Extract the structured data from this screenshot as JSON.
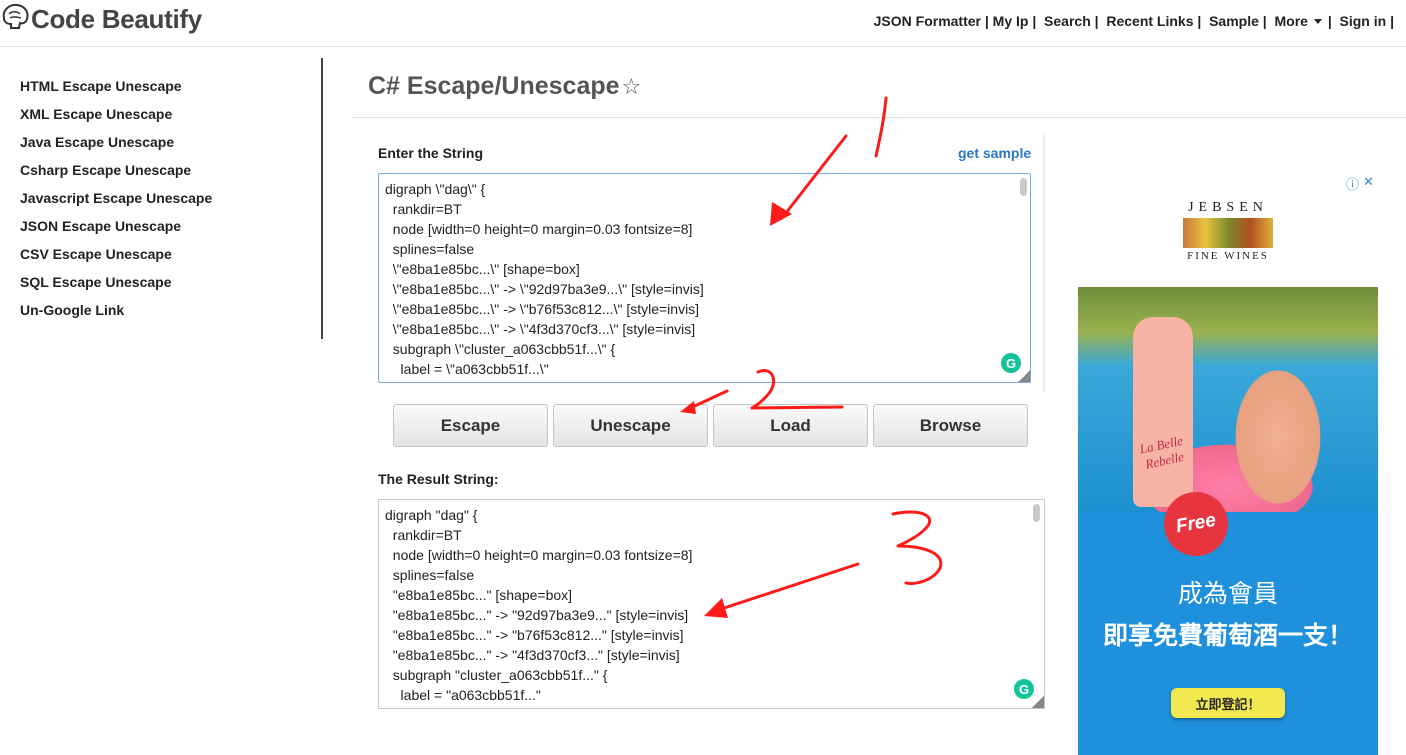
{
  "header": {
    "logo_text": "Code Beautify",
    "nav": [
      {
        "label": "JSON Formatter |"
      },
      {
        "label": " My Ip |"
      },
      {
        "label": "  Search |"
      },
      {
        "label": "  Recent Links |"
      },
      {
        "label": "  Sample |"
      },
      {
        "label": "  More",
        "has_caret": true
      },
      {
        "label": " |"
      },
      {
        "label": "  Sign in |"
      }
    ]
  },
  "sidebar": {
    "items": [
      {
        "label": "HTML Escape Unescape"
      },
      {
        "label": "XML Escape Unescape"
      },
      {
        "label": "Java Escape Unescape"
      },
      {
        "label": "Csharp Escape Unescape"
      },
      {
        "label": "Javascript Escape Unescape"
      },
      {
        "label": "JSON Escape Unescape"
      },
      {
        "label": "CSV Escape Unescape"
      },
      {
        "label": "SQL Escape Unescape"
      },
      {
        "label": "Un-Google Link"
      }
    ]
  },
  "main": {
    "title": "C# Escape/Unescape",
    "input_label": "Enter the String",
    "get_sample": "get sample",
    "input_text": "digraph \\\"dag\\\" {\n  rankdir=BT\n  node [width=0 height=0 margin=0.03 fontsize=8]\n  splines=false\n  \\\"e8ba1e85bc...\\\" [shape=box]\n  \\\"e8ba1e85bc...\\\" -> \\\"92d97ba3e9...\\\" [style=invis]\n  \\\"e8ba1e85bc...\\\" -> \\\"b76f53c812...\\\" [style=invis]\n  \\\"e8ba1e85bc...\\\" -> \\\"4f3d370cf3...\\\" [style=invis]\n  subgraph \\\"cluster_a063cbb51f...\\\" {\n    label = \\\"a063cbb51f...\\\"",
    "buttons": {
      "escape": "Escape",
      "unescape": "Unescape",
      "load": "Load",
      "browse": "Browse"
    },
    "result_label": "The Result String:",
    "result_text": "digraph \"dag\" {\n  rankdir=BT\n  node [width=0 height=0 margin=0.03 fontsize=8]\n  splines=false\n  \"e8ba1e85bc...\" [shape=box]\n  \"e8ba1e85bc...\" -> \"92d97ba3e9...\" [style=invis]\n  \"e8ba1e85bc...\" -> \"b76f53c812...\" [style=invis]\n  \"e8ba1e85bc...\" -> \"4f3d370cf3...\" [style=invis]\n  subgraph \"cluster_a063cbb51f...\" {\n    label = \"a063cbb51f...\""
  },
  "ads": {
    "info_icon": "info-icon",
    "close_icon": "close-icon",
    "brand_name": "JEBSEN",
    "brand_sub": "FINE WINES",
    "bottle_label": "La Belle Rebelle",
    "badge": "Free",
    "line1": "成為會員",
    "line2": "即享免費葡萄酒一支！",
    "cta": "立即登記！"
  },
  "colors": {
    "link": "#2a78c4",
    "annotation": "#ff1a1a",
    "ad_background": "#1e90dc",
    "ad_cta": "#f2e74e"
  }
}
